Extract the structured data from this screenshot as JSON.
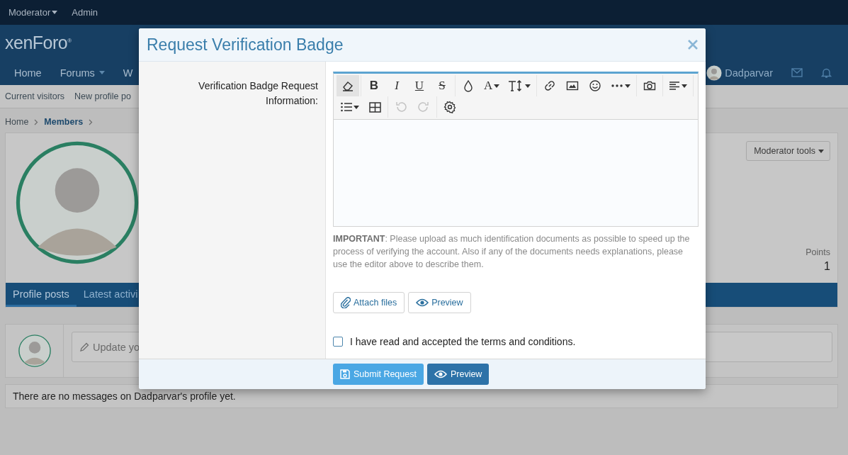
{
  "top_bar": {
    "items": [
      {
        "label": "Moderator",
        "dropdown": true
      },
      {
        "label": "Admin",
        "dropdown": false
      }
    ]
  },
  "header": {
    "logo": "xenForo$^{®}$"
  },
  "nav": {
    "tabs": [
      {
        "label": "Home",
        "dropdown": false
      },
      {
        "label": "Forums",
        "dropdown": true
      },
      {
        "label": "W",
        "dropdown": false
      }
    ],
    "user": "Dadparvar"
  },
  "sub_nav": [
    "Current visitors",
    "New profile po"
  ],
  "breadcrumb": [
    {
      "label": "Home",
      "current": false
    },
    {
      "label": "Members",
      "current": true
    }
  ],
  "profile": {
    "moderator_tools": "Moderator tools",
    "stats": [
      {
        "label": "Points",
        "value": "1"
      }
    ],
    "tabs": [
      {
        "label": "Profile posts",
        "selected": true
      },
      {
        "label": "Latest activi",
        "selected": false
      }
    ],
    "status_placeholder": "Update yo",
    "empty_message": "There are no messages on Dadparvar's profile yet."
  },
  "dialog": {
    "title": "Request Verification Badge",
    "label": "Verification Badge Request Information:",
    "toolbar": [
      [
        {
          "kind": "eraser",
          "selected": true,
          "disabled": false,
          "dropdown": false
        }
      ],
      [
        {
          "kind": "bold",
          "text": "B",
          "selected": false,
          "disabled": false,
          "dropdown": false
        },
        {
          "kind": "italic",
          "text": "I",
          "selected": false,
          "disabled": false,
          "dropdown": false
        },
        {
          "kind": "underline",
          "text": "U",
          "selected": false,
          "disabled": false,
          "dropdown": false
        },
        {
          "kind": "strike",
          "text": "S",
          "selected": false,
          "disabled": false,
          "dropdown": false
        }
      ],
      [
        {
          "kind": "color",
          "selected": false,
          "disabled": false,
          "dropdown": false
        },
        {
          "kind": "font",
          "text": "A",
          "selected": false,
          "disabled": false,
          "dropdown": true
        },
        {
          "kind": "size",
          "selected": false,
          "disabled": false,
          "dropdown": true
        }
      ],
      [
        {
          "kind": "link",
          "selected": false,
          "disabled": false,
          "dropdown": false
        },
        {
          "kind": "image",
          "selected": false,
          "disabled": false,
          "dropdown": false
        },
        {
          "kind": "smilie",
          "selected": false,
          "disabled": false,
          "dropdown": false
        },
        {
          "kind": "more",
          "selected": false,
          "disabled": false,
          "dropdown": true
        }
      ],
      [
        {
          "kind": "camera",
          "selected": false,
          "disabled": false,
          "dropdown": false
        }
      ],
      [
        {
          "kind": "align",
          "selected": false,
          "disabled": false,
          "dropdown": true
        }
      ],
      [
        {
          "kind": "list",
          "selected": false,
          "disabled": false,
          "dropdown": true
        },
        {
          "kind": "table",
          "selected": false,
          "disabled": false,
          "dropdown": false
        }
      ],
      [
        {
          "kind": "undo",
          "selected": false,
          "disabled": true,
          "dropdown": false
        },
        {
          "kind": "redo",
          "selected": false,
          "disabled": true,
          "dropdown": false
        }
      ],
      [
        {
          "kind": "gear",
          "selected": false,
          "disabled": false,
          "dropdown": false
        }
      ]
    ],
    "note": "**IMPORTANT**: Please upload as much identification documents as possible to speed up the process of verifying the account. Also if any of the documents needs explanations, please use the editor above to describe them.",
    "attach": "Attach files",
    "preview": "Preview",
    "terms": {
      "label": "I have read and accepted the terms and conditions.",
      "checked": false
    },
    "footer_buttons": [
      {
        "label": "Submit Request",
        "kind": "submit"
      },
      {
        "label": "Preview",
        "kind": "preview"
      }
    ]
  }
}
